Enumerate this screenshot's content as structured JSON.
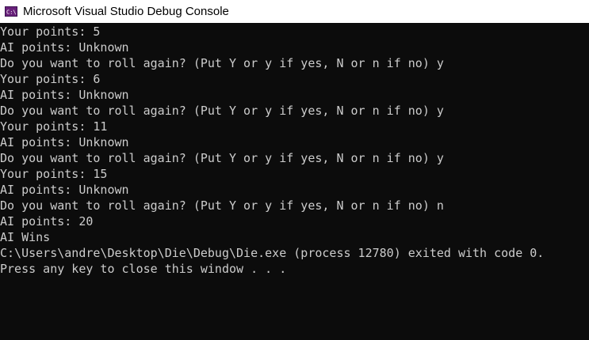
{
  "window": {
    "title": "Microsoft Visual Studio Debug Console",
    "icon": "console-app-icon",
    "icon_label": "C:\\"
  },
  "console": {
    "lines": [
      "Your points: 5",
      "AI points: Unknown",
      "Do you want to roll again? (Put Y or y if yes, N or n if no) y",
      "Your points: 6",
      "AI points: Unknown",
      "Do you want to roll again? (Put Y or y if yes, N or n if no) y",
      "Your points: 11",
      "AI points: Unknown",
      "Do you want to roll again? (Put Y or y if yes, N or n if no) y",
      "Your points: 15",
      "AI points: Unknown",
      "Do you want to roll again? (Put Y or y if yes, N or n if no) n",
      "AI points: 20",
      "AI Wins",
      "C:\\Users\\andre\\Desktop\\Die\\Debug\\Die.exe (process 12780) exited with code 0.",
      "Press any key to close this window . . ."
    ]
  },
  "colors": {
    "background": "#0c0c0c",
    "text": "#cccccc",
    "titlebar": "#ffffff",
    "icon_accent": "#68217a"
  }
}
